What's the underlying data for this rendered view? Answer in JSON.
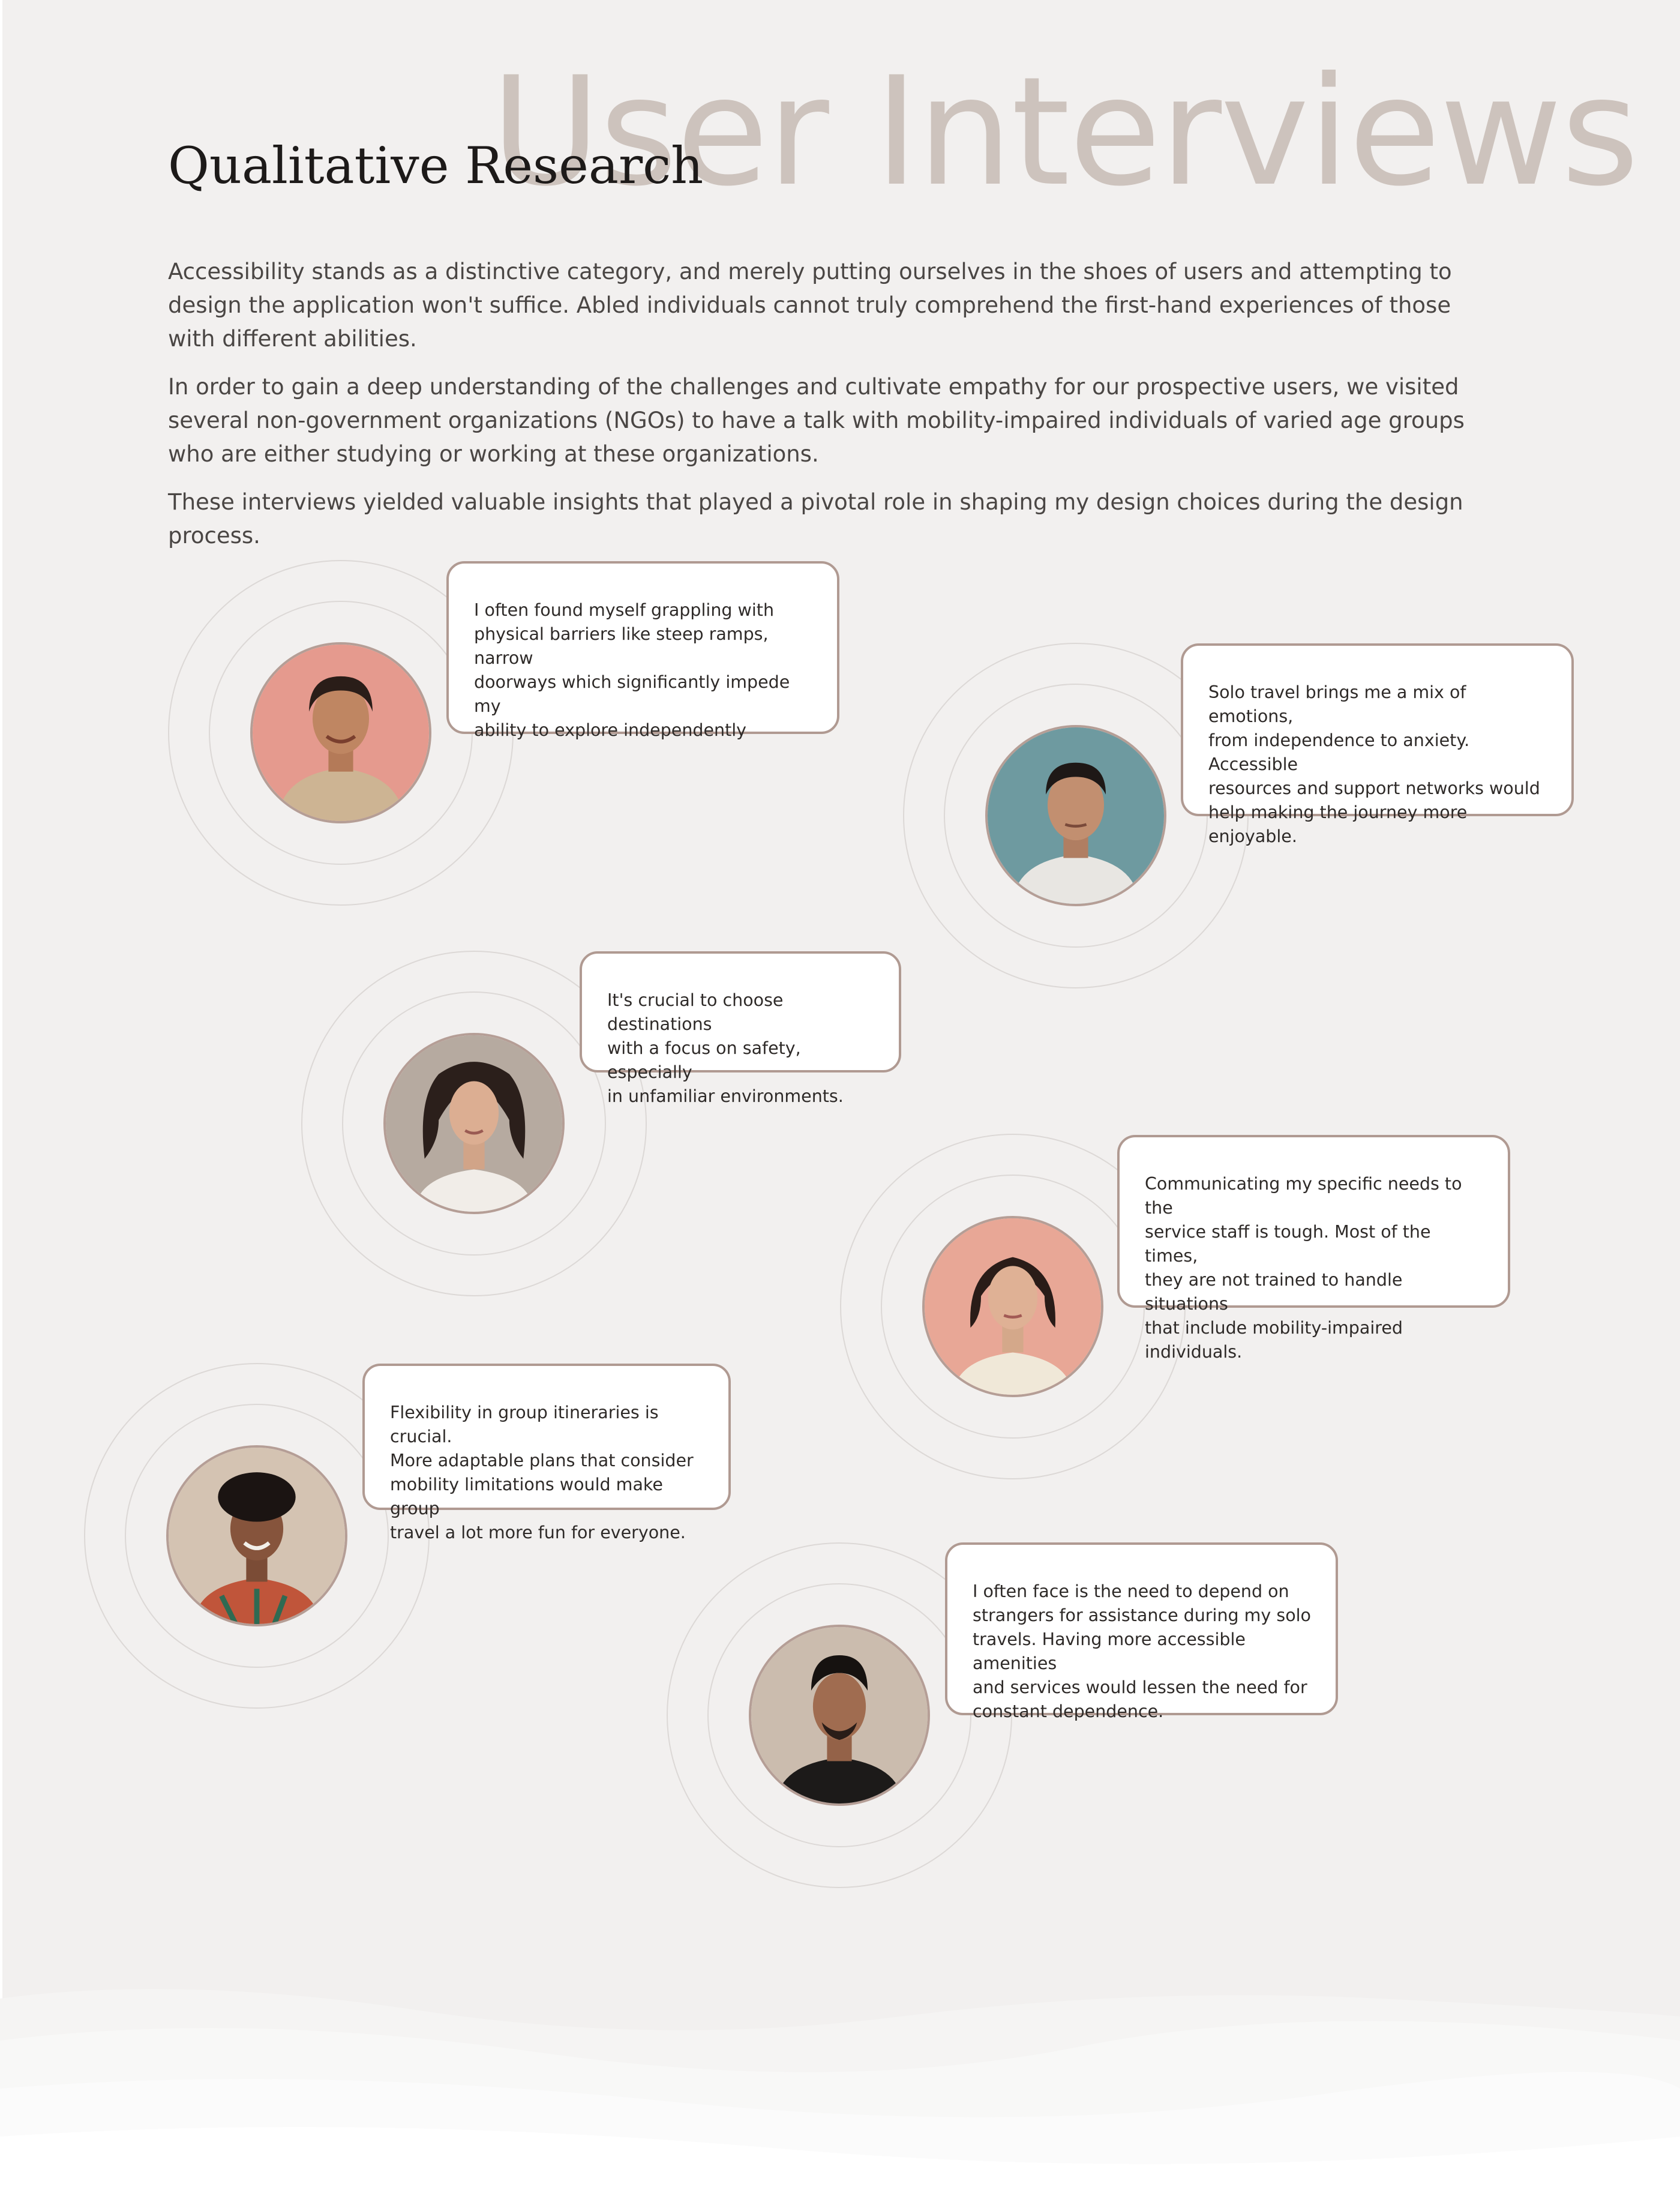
{
  "header": {
    "watermark": "User Interviews",
    "title": "Qualitative Research"
  },
  "intro": {
    "paragraphs": [
      "Accessibility stands as a distinctive category, and merely putting ourselves in the shoes of users and attempting to design the application won't suffice. Abled individuals cannot truly comprehend the first-hand experiences of those with different abilities.",
      "In order to gain a deep understanding of the challenges and cultivate empathy for our prospective users, we visited several non-government organizations (NGOs) to have a talk with mobility-impaired individuals of varied age groups who are either studying or working at these organizations.",
      "These interviews yielded valuable insights that played a pivotal role in shaping my design choices during the design process."
    ]
  },
  "interviews": [
    {
      "quote": "I often found myself grappling with\nphysical barriers like steep ramps, narrow\ndoorways which significantly impede my\nability to explore independently",
      "avatar_bg": "#e59a8e"
    },
    {
      "quote": "Solo travel brings me a mix of emotions,\nfrom independence to anxiety. Accessible\nresources and support networks would\nhelp making the journey more enjoyable.",
      "avatar_bg": "#6e9aa0"
    },
    {
      "quote": "It's crucial to choose destinations\nwith a focus on safety, especially\nin unfamiliar environments.",
      "avatar_bg": "#b6aaa0"
    },
    {
      "quote": "Communicating my specific needs to the\nservice staff is tough. Most of the times,\nthey are not trained to handle situations\nthat include mobility-impaired individuals.",
      "avatar_bg": "#e8a796"
    },
    {
      "quote": "Flexibility in group itineraries is crucial.\nMore adaptable plans that consider\nmobility limitations would make group\ntravel a lot more fun for everyone.",
      "avatar_bg": "#d4c3b2"
    },
    {
      "quote": "I often face is  the need to depend on\nstrangers for assistance during my solo\ntravels. Having more accessible amenities\nand services would lessen the need for\nconstant dependence.",
      "avatar_bg": "#cbbcae"
    }
  ]
}
